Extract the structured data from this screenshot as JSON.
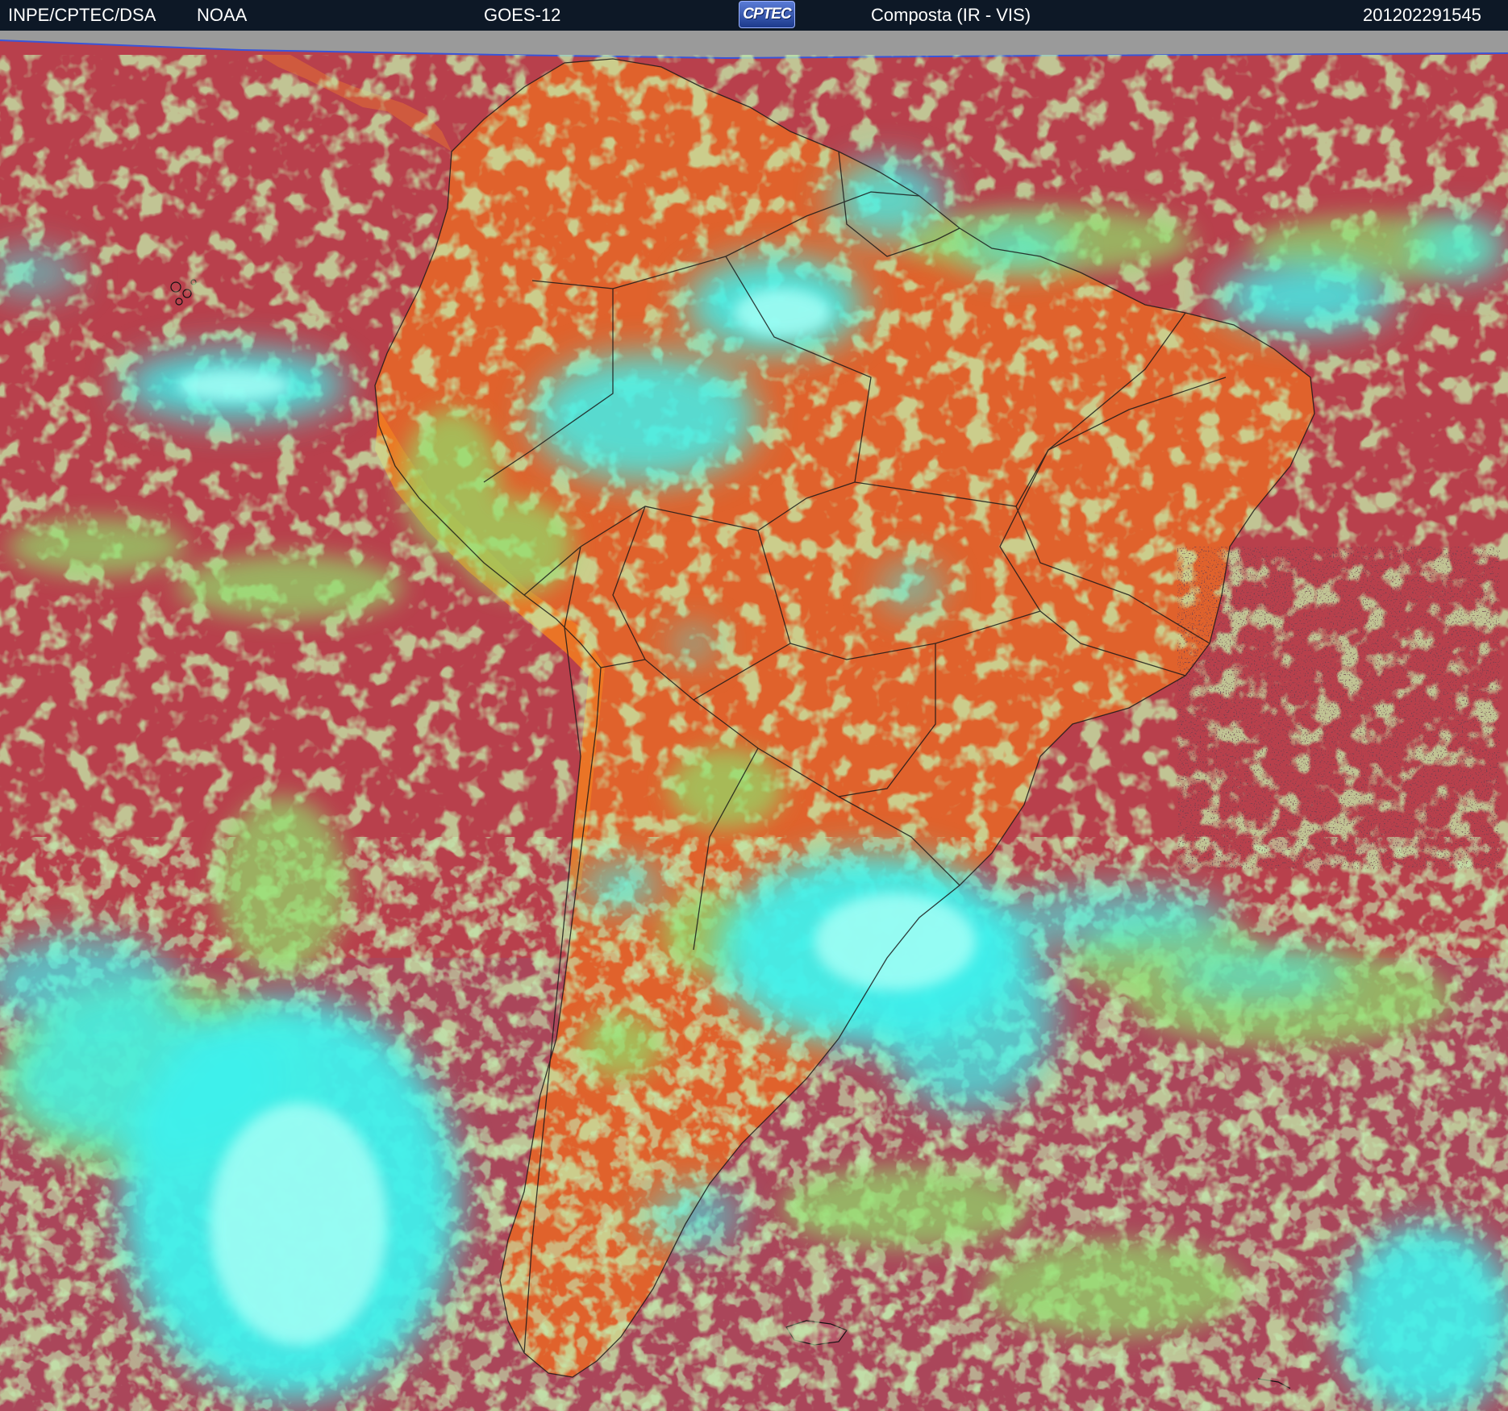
{
  "header": {
    "source": "INPE/CPTEC/DSA",
    "agency": "NOAA",
    "satellite": "GOES-12",
    "logo_text": "CPTEC",
    "product": "Composta (IR - VIS)",
    "timestamp": "201202291545"
  },
  "colors": {
    "header_bg": "#0d1826",
    "ocean_clear": "#b8404c",
    "land_clear": "#e0622c",
    "low_cloud": "#8fe06a",
    "high_cloud": "#3ff0ec",
    "no_data": "#9a9a9a",
    "borders": "#1a1a1a"
  }
}
